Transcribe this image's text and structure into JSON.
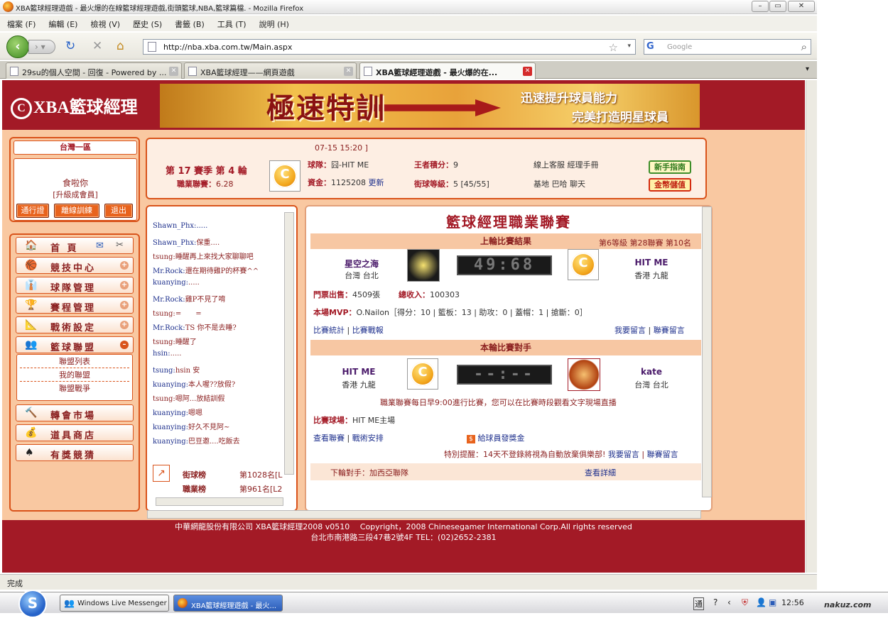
{
  "window": {
    "title": "XBA籃球經理遊戲 - 最火爆的在線籃球經理遊戲,街頭籃球,NBA,籃球篇檔. - Mozilla Firefox"
  },
  "menu": [
    "檔案 (F)",
    "編輯 (E)",
    "檢視 (V)",
    "歷史 (S)",
    "書籤 (B)",
    "工具 (T)",
    "說明 (H)"
  ],
  "nav": {
    "url": "http://nba.xba.com.tw/Main.aspx",
    "search_engine": "G",
    "search_placeholder": "Google"
  },
  "tabs": [
    {
      "label": "29su的個人空間 - 回復 - Powered by ..."
    },
    {
      "label": "XBA籃球經理——網頁遊戲"
    },
    {
      "label": "XBA籃球經理遊戲 - 最火爆的在..."
    }
  ],
  "site": {
    "logo": "XBA籃球經理",
    "logo_mark": "C",
    "banner_title": "極速特訓",
    "banner_line1": "迅速提升球員能力",
    "banner_line2": "完美打造明星球員"
  },
  "user": {
    "region": "台灣一區",
    "name": "食啦你",
    "level": "[升級成會員]",
    "buttons": [
      "通行證",
      "離線訓練",
      "退出"
    ]
  },
  "left_menu": [
    {
      "icon": "home-icon",
      "glyph": "🏠",
      "label": "首 頁"
    },
    {
      "icon": "basketball-icon",
      "glyph": "🏀",
      "label": "競技中心"
    },
    {
      "icon": "team-icon",
      "glyph": "👔",
      "label": "球隊管理"
    },
    {
      "icon": "trophy-icon",
      "glyph": "🏆",
      "label": "賽程管理"
    },
    {
      "icon": "tactics-icon",
      "glyph": "📐",
      "label": "戰術設定"
    },
    {
      "icon": "league-icon",
      "glyph": "👥",
      "label": "籃球聯盟"
    },
    {
      "icon": "hammer-icon",
      "glyph": "🔨",
      "label": "轉會市場"
    },
    {
      "icon": "gold-icon",
      "glyph": "💰",
      "label": "道具商店"
    },
    {
      "icon": "spade-icon",
      "glyph": "♠",
      "label": "有獎競猜"
    }
  ],
  "league_submenu": [
    "聯盟列表",
    "我的聯盟",
    "聯盟戰爭"
  ],
  "info": {
    "time": "07-15 15:20 ]",
    "season": "第 17 賽季 第 4 輪",
    "league_points_label": "職業聯賽：",
    "league_points": "6.28",
    "team_label": "球隊：",
    "team": "囧-HIT ME",
    "funds_label": "資金：",
    "funds": "1125208",
    "update": "更新",
    "king_label": "王者積分：",
    "king": "9",
    "street_label": "街球等級：",
    "street": "5 [45/55]",
    "links1": "線上客服 經理手冊",
    "links2": "基地 巴哈 聊天",
    "guide_btn": "新手指南",
    "store_btn": "金幣儲值"
  },
  "chat": [
    {
      "user": "Shawn_Phx:",
      "text": "....."
    },
    {
      "user": "Shawn_Phx:",
      "text": "保重...."
    },
    {
      "user": "tsung:",
      "text": "睡醒再上來找大家聊聊吧"
    },
    {
      "user": "Mr.Rock:",
      "text": "還在期待雞P的杯賽^^"
    },
    {
      "user": "kuanying:",
      "text": "....."
    },
    {
      "user": "Mr.Rock:",
      "text": "雞P不見了唷"
    },
    {
      "user": "tsung:",
      "text": "=　　="
    },
    {
      "user": "Mr.Rock:",
      "text": "TS 你不是去睡?"
    },
    {
      "user": "tsung:",
      "text": "睡醒了"
    },
    {
      "user": "hsin:",
      "text": "....."
    },
    {
      "user": "tsung:",
      "text": "hsin 安"
    },
    {
      "user": "kuanying:",
      "text": "本人喔??放假?"
    },
    {
      "user": "tsung:",
      "text": "嗯阿...放結訓假"
    },
    {
      "user": "kuanying:",
      "text": "嗯嗯"
    },
    {
      "user": "kuanying:",
      "text": "好久不見阿~"
    },
    {
      "user": "kuanying:",
      "text": "巴豆邀....吃飯去"
    }
  ],
  "ranks": [
    {
      "label": "街球榜",
      "value": "第1028名[L"
    },
    {
      "label": "職業榜",
      "value": "第961名[L2"
    }
  ],
  "league": {
    "title": "籃球經理職業聯賽",
    "last_result": "上輪比賽結果",
    "level_info": "第6等級 第28聯賽 第10名",
    "home_team": "星空之海",
    "home_loc": "台灣 台北",
    "away_team": "HIT ME",
    "away_loc": "香港 九龍",
    "score": "49:68",
    "tickets_label": "門票出售：",
    "tickets": "4509張",
    "income_label": "總收入：",
    "income": "100303",
    "mvp_label": "本場MVP：",
    "mvp": "O.Nailon［得分：10 | 籃板：13 | 助攻：0 | 蓋帽：1 | 搶斷：0］",
    "stats_link": "比賽統計",
    "report_link": "比賽戰報",
    "msg_link": "我要留言",
    "league_msg_link": "聯賽留言",
    "this_round": "本輪比賽對手",
    "opp_home": "HIT ME",
    "opp_home_loc": "香港 九龍",
    "opp_away": "kate",
    "opp_away_loc": "台灣 台北",
    "pending_score": "--:--",
    "notice": "職業聯賽每日早9:00進行比賽，您可以在比賽時段觀看文字現場直播",
    "venue_label": "比賽球場：",
    "venue": "HIT ME主場",
    "view_league": "查看聯賽",
    "tactics": "戰術安排",
    "bonus": "給球員發獎金",
    "warning_label": "特別提醒：",
    "warning": "14天不登錄將視為自動放棄俱樂部!",
    "next_label": "下輪對手：",
    "next_opp": "加西亞聯隊",
    "detail": "查看詳細"
  },
  "footer": {
    "line1": "中華網龍股份有限公司 XBA籃球經理2008 v0510　 Copyright，2008 Chinesegamer International Corp.All rights reserved",
    "line2": "台北市南港路三段47巷2號4F TEL：(02)2652-2381"
  },
  "status": "完成",
  "taskbar": {
    "messenger": "Windows Live Messenger",
    "firefox": "XBA籃球經理遊戲 - 最火...",
    "clock": "12:56"
  },
  "watermark": "nakuz.com"
}
